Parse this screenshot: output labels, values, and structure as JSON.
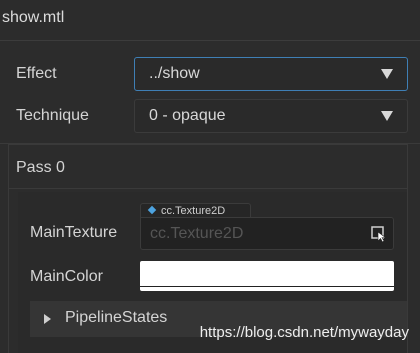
{
  "header": {
    "file_title": "show.mtl"
  },
  "effect": {
    "label": "Effect",
    "value": "../show"
  },
  "technique": {
    "label": "Technique",
    "value": "0 - opaque"
  },
  "pass": {
    "title": "Pass 0",
    "main_texture": {
      "label": "MainTexture",
      "type_tag": "cc.Texture2D",
      "placeholder": "cc.Texture2D"
    },
    "main_color": {
      "label": "MainColor",
      "color": "#ffffff"
    },
    "pipeline_states": {
      "label": "PipelineStates"
    }
  },
  "watermark": "https://blog.csdn.net/mywayday",
  "colors": {
    "background": "#2c2c2c",
    "focus_border": "#3f7fb5",
    "type_diamond": "#4da3e0"
  },
  "icons": {
    "dropdown_arrow": "caret-down",
    "texture_picker": "cursor-select-icon",
    "expand": "caret-right"
  }
}
